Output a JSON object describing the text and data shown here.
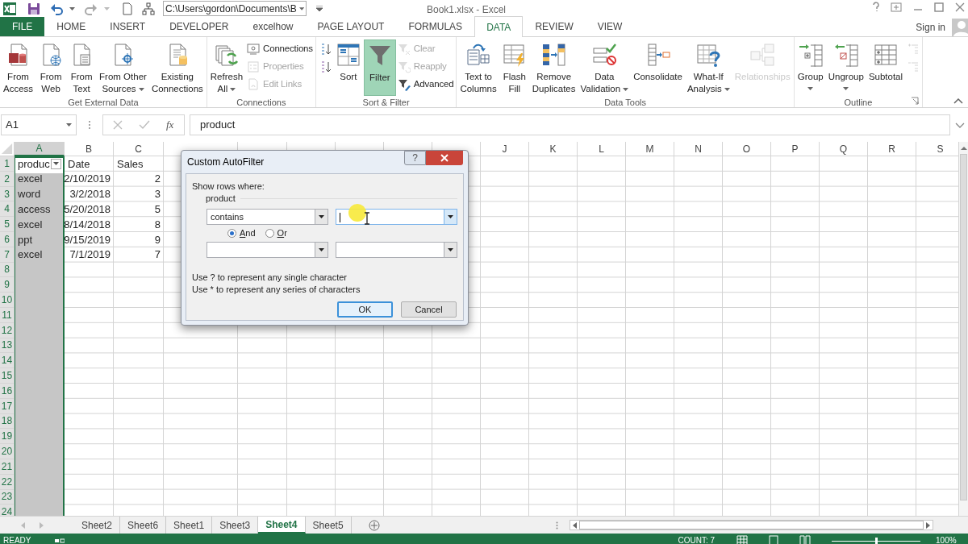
{
  "window": {
    "title": "Book1.xlsx - Excel"
  },
  "quick_access": {
    "path": "C:\\Users\\gordon\\Documents\\B"
  },
  "tabs": [
    {
      "label": "FILE",
      "kind": "file",
      "selected": false
    },
    {
      "label": "HOME",
      "kind": "tab",
      "selected": false
    },
    {
      "label": "INSERT",
      "kind": "tab",
      "selected": false
    },
    {
      "label": "DEVELOPER",
      "kind": "tab",
      "selected": false
    },
    {
      "label": "excelhow",
      "kind": "tab",
      "selected": false
    },
    {
      "label": "PAGE LAYOUT",
      "kind": "tab",
      "selected": false
    },
    {
      "label": "FORMULAS",
      "kind": "tab",
      "selected": false
    },
    {
      "label": "DATA",
      "kind": "tab",
      "selected": true
    },
    {
      "label": "REVIEW",
      "kind": "tab",
      "selected": false
    },
    {
      "label": "VIEW",
      "kind": "tab",
      "selected": false
    }
  ],
  "account": {
    "label": "Sign in"
  },
  "ribbon": [
    {
      "label": "Get External Data",
      "items": [
        {
          "kind": "large",
          "lines": [
            "From",
            "Access"
          ],
          "dropdown": false,
          "disabled": false,
          "on": false
        },
        {
          "kind": "large",
          "lines": [
            "From",
            "Web"
          ],
          "dropdown": false,
          "disabled": false,
          "on": false
        },
        {
          "kind": "large",
          "lines": [
            "From",
            "Text"
          ],
          "dropdown": false,
          "disabled": false,
          "on": false
        },
        {
          "kind": "large",
          "lines": [
            "From Other",
            "Sources"
          ],
          "dropdown": true,
          "disabled": false,
          "on": false
        },
        {
          "kind": "large",
          "lines": [
            "Existing",
            "Connections"
          ],
          "dropdown": false,
          "disabled": false,
          "on": false
        }
      ]
    },
    {
      "label": "Connections",
      "items": [
        {
          "kind": "large",
          "lines": [
            "Refresh",
            "All"
          ],
          "dropdown": true,
          "disabled": false,
          "on": false
        },
        {
          "kind": "stack",
          "items": [
            {
              "label": "Connections",
              "disabled": false
            },
            {
              "label": "Properties",
              "disabled": true
            },
            {
              "label": "Edit Links",
              "disabled": true
            }
          ]
        }
      ]
    },
    {
      "label": "Sort & Filter",
      "items": [
        {
          "kind": "stack",
          "items": [
            {
              "disabled": false
            },
            {
              "disabled": false
            }
          ]
        },
        {
          "kind": "large",
          "lines": [
            "Sort"
          ],
          "dropdown": false,
          "disabled": false,
          "on": false
        },
        {
          "kind": "large",
          "lines": [
            "Filter"
          ],
          "dropdown": false,
          "disabled": false,
          "on": true
        },
        {
          "kind": "stack",
          "items": [
            {
              "label": "Clear",
              "disabled": true
            },
            {
              "label": "Reapply",
              "disabled": true
            },
            {
              "label": "Advanced",
              "disabled": false
            }
          ]
        }
      ]
    },
    {
      "label": "Data Tools",
      "items": [
        {
          "kind": "large",
          "lines": [
            "Text to",
            "Columns"
          ],
          "dropdown": false,
          "disabled": false,
          "on": false
        },
        {
          "kind": "large",
          "lines": [
            "Flash",
            "Fill"
          ],
          "dropdown": false,
          "disabled": false,
          "on": false
        },
        {
          "kind": "large",
          "lines": [
            "Remove",
            "Duplicates"
          ],
          "dropdown": false,
          "disabled": false,
          "on": false
        },
        {
          "kind": "large",
          "lines": [
            "Data",
            "Validation"
          ],
          "dropdown": true,
          "disabled": false,
          "on": false
        },
        {
          "kind": "large",
          "lines": [
            "Consolidate"
          ],
          "dropdown": false,
          "disabled": false,
          "on": false
        },
        {
          "kind": "large",
          "lines": [
            "What-If",
            "Analysis"
          ],
          "dropdown": true,
          "disabled": false,
          "on": false
        },
        {
          "kind": "large",
          "lines": [
            "Relationships"
          ],
          "dropdown": false,
          "disabled": true,
          "on": false
        }
      ]
    },
    {
      "label": "Outline",
      "launcher": true,
      "items": [
        {
          "kind": "large",
          "lines": [
            "Group"
          ],
          "dropdown": true,
          "disabled": false,
          "on": false
        },
        {
          "kind": "large",
          "lines": [
            "Ungroup"
          ],
          "dropdown": true,
          "disabled": false,
          "on": false
        },
        {
          "kind": "large",
          "lines": [
            "Subtotal"
          ],
          "dropdown": false,
          "disabled": false,
          "on": false
        },
        {
          "kind": "stack",
          "items": [
            {
              "disabled": true
            },
            {
              "disabled": true
            }
          ]
        }
      ]
    }
  ],
  "formula_bar": {
    "name_box": "A1",
    "insert_function": "fx",
    "formula": "product"
  },
  "sheet": {
    "columns": [
      {
        "label": "A",
        "selected": true
      },
      {
        "label": "B",
        "selected": false
      },
      {
        "label": "C",
        "selected": false
      },
      {
        "selected": false
      },
      {
        "selected": false
      },
      {
        "selected": false
      },
      {
        "selected": false
      },
      {
        "selected": false
      },
      {
        "selected": false
      },
      {
        "label": "J",
        "selected": false
      },
      {
        "label": "K",
        "selected": false
      },
      {
        "label": "L",
        "selected": false
      },
      {
        "label": "M",
        "selected": false
      },
      {
        "label": "N",
        "selected": false
      },
      {
        "label": "O",
        "selected": false
      },
      {
        "label": "P",
        "selected": false
      },
      {
        "label": "Q",
        "selected": false
      },
      {
        "label": "R",
        "selected": false
      },
      {
        "label": "S",
        "selected": false
      }
    ],
    "rows": [
      {
        "label": "1",
        "active": true,
        "cells": [
          "produc",
          "Date",
          "Sales"
        ],
        "filters": [
          true,
          false,
          false
        ]
      },
      {
        "label": "2",
        "active": false,
        "cells": [
          "excel",
          "2/10/2019",
          "2"
        ]
      },
      {
        "label": "3",
        "active": false,
        "cells": [
          "word",
          "3/2/2018",
          "3"
        ]
      },
      {
        "label": "4",
        "active": false,
        "cells": [
          "access",
          "5/20/2018",
          "5"
        ]
      },
      {
        "label": "5",
        "active": false,
        "cells": [
          "excel",
          "8/14/2018",
          "8"
        ]
      },
      {
        "label": "6",
        "active": false,
        "cells": [
          "ppt",
          "9/15/2019",
          "9"
        ]
      },
      {
        "label": "7",
        "active": false,
        "cells": [
          "excel",
          "7/1/2019",
          "7"
        ]
      },
      {
        "label": "8",
        "active": false
      },
      {
        "label": "9",
        "active": false
      },
      {
        "label": "10",
        "active": false
      },
      {
        "label": "11",
        "active": false
      },
      {
        "label": "12",
        "active": false
      },
      {
        "label": "13",
        "active": false
      },
      {
        "label": "14",
        "active": false
      },
      {
        "label": "15",
        "active": false
      },
      {
        "label": "16",
        "active": false
      },
      {
        "label": "17",
        "active": false
      },
      {
        "label": "18",
        "active": false
      },
      {
        "label": "19",
        "active": false
      },
      {
        "label": "20",
        "active": false
      },
      {
        "label": "21",
        "active": false
      },
      {
        "label": "22",
        "active": false
      },
      {
        "label": "23",
        "active": false
      },
      {
        "label": "24",
        "active": false
      }
    ]
  },
  "sheet_tabs": [
    {
      "label": "Sheet2",
      "selected": false
    },
    {
      "label": "Sheet6",
      "selected": false
    },
    {
      "label": "Sheet1",
      "selected": false
    },
    {
      "label": "Sheet3",
      "selected": false
    },
    {
      "label": "Sheet4",
      "selected": true
    },
    {
      "label": "Sheet5",
      "selected": false
    }
  ],
  "status_bar": {
    "mode": "READY",
    "summary": "COUNT: 7",
    "zoom": "100%",
    "zoom_slider": {
      "level": 0.5
    }
  },
  "dialog": {
    "title": "Custom AutoFilter",
    "help": "?",
    "prompt": "Show rows where:",
    "field": "product",
    "criteria": [
      {
        "operator": "contains",
        "focused": true
      },
      {
        "focused": false
      }
    ],
    "join": [
      {
        "label": "And",
        "selected": true
      },
      {
        "label": "Or",
        "selected": false
      }
    ],
    "hints": [
      "Use ? to represent any single character",
      "Use * to represent any series of characters"
    ],
    "buttons": [
      {
        "label": "OK",
        "default": true
      },
      {
        "label": "Cancel",
        "default": false
      }
    ]
  }
}
